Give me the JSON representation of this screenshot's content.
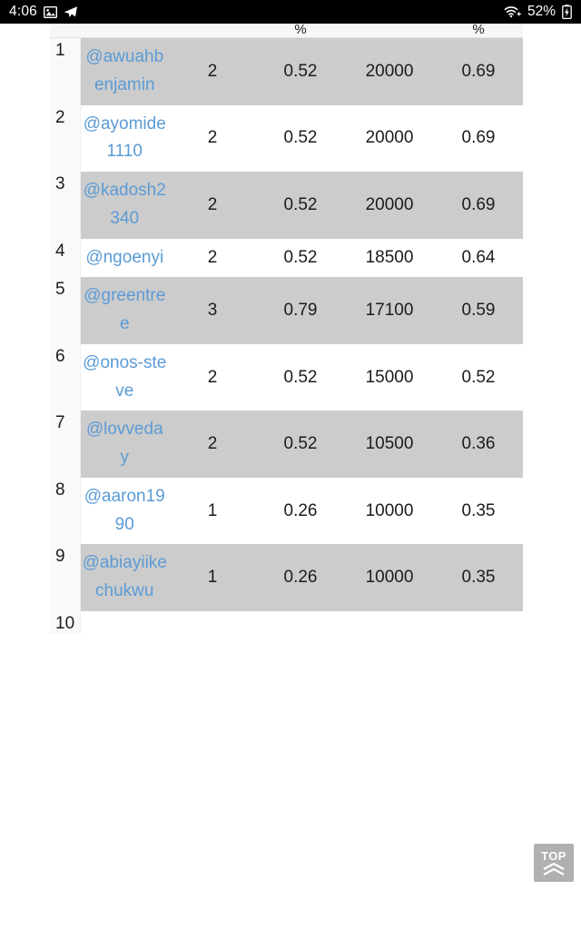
{
  "status_bar": {
    "clock": "4:06",
    "left_icons": [
      "image-icon",
      "telegram-send-icon"
    ],
    "wifi_icon": "wifi-icon",
    "battery_percent": "52%",
    "battery_icon": "battery-charging-icon",
    "background_color": "#000000",
    "text_color": "#ffffff"
  },
  "table": {
    "headers": [
      "",
      "",
      "",
      "%",
      "",
      "%"
    ],
    "sort_indicator": "⇅",
    "row_stripe_color": "#cccccc",
    "link_color": "#5b9bd5",
    "rows": [
      {
        "index": "1",
        "username": "@awuahbenjamin",
        "col_a": "2",
        "col_b": "0.52",
        "col_c": "20000",
        "col_d": "0.69"
      },
      {
        "index": "2",
        "username": "@ayomide1110",
        "col_a": "2",
        "col_b": "0.52",
        "col_c": "20000",
        "col_d": "0.69"
      },
      {
        "index": "3",
        "username": "@kadosh2340",
        "col_a": "2",
        "col_b": "0.52",
        "col_c": "20000",
        "col_d": "0.69"
      },
      {
        "index": "4",
        "username": "@ngoenyi",
        "col_a": "2",
        "col_b": "0.52",
        "col_c": "18500",
        "col_d": "0.64"
      },
      {
        "index": "5",
        "username": "@greentree",
        "col_a": "3",
        "col_b": "0.79",
        "col_c": "17100",
        "col_d": "0.59"
      },
      {
        "index": "6",
        "username": "@onos-steve",
        "col_a": "2",
        "col_b": "0.52",
        "col_c": "15000",
        "col_d": "0.52"
      },
      {
        "index": "7",
        "username": "@lovveday",
        "col_a": "2",
        "col_b": "0.52",
        "col_c": "10500",
        "col_d": "0.36"
      },
      {
        "index": "8",
        "username": "@aaron1990",
        "col_a": "1",
        "col_b": "0.26",
        "col_c": "10000",
        "col_d": "0.35"
      },
      {
        "index": "9",
        "username": "@abiayiikechukwu",
        "col_a": "1",
        "col_b": "0.26",
        "col_c": "10000",
        "col_d": "0.35"
      },
      {
        "index": "10",
        "username": "",
        "col_a": "",
        "col_b": "",
        "col_c": "",
        "col_d": ""
      }
    ]
  },
  "scroll_top_button": {
    "label": "TOP",
    "icon": "double-chevron-up-icon",
    "background_color": "#b0b0b0"
  }
}
